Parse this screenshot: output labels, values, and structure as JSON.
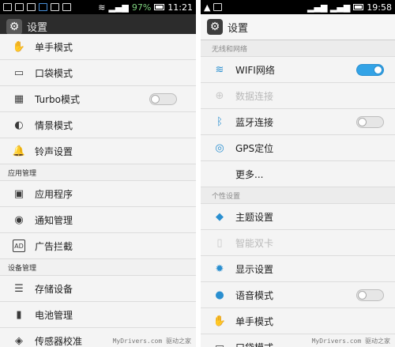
{
  "left": {
    "status": {
      "battery_pct": "97%",
      "time": "11:21"
    },
    "title": "设置",
    "rows": [
      {
        "type": "item",
        "icon": "hand-icon",
        "glyph": "✋",
        "label": "单手模式"
      },
      {
        "type": "item",
        "icon": "pocket-icon",
        "glyph": "▭",
        "label": "口袋模式"
      },
      {
        "type": "item",
        "icon": "chip-icon",
        "glyph": "▦",
        "label": "Turbo模式",
        "toggle": "off"
      },
      {
        "type": "item",
        "icon": "scene-icon",
        "glyph": "◐",
        "label": "情景模式"
      },
      {
        "type": "item",
        "icon": "bell-icon",
        "glyph": "🔔",
        "label": "铃声设置"
      },
      {
        "type": "section",
        "label": "应用管理"
      },
      {
        "type": "item",
        "icon": "apps-icon",
        "glyph": "▣",
        "label": "应用程序"
      },
      {
        "type": "item",
        "icon": "notification-icon",
        "glyph": "◉",
        "label": "通知管理"
      },
      {
        "type": "item",
        "icon": "ad-block-icon",
        "glyph": "AD",
        "label": "广告拦截"
      },
      {
        "type": "section",
        "label": "设备管理"
      },
      {
        "type": "item",
        "icon": "storage-icon",
        "glyph": "☰",
        "label": "存储设备"
      },
      {
        "type": "item",
        "icon": "battery-icon",
        "glyph": "▮",
        "label": "电池管理"
      },
      {
        "type": "item",
        "icon": "sensor-icon",
        "glyph": "◈",
        "label": "传感器校准"
      }
    ],
    "watermark": "MyDrivers.com 驱动之家"
  },
  "right": {
    "status": {
      "time": "19:58"
    },
    "title": "设置",
    "rows": [
      {
        "type": "section",
        "label": "无线和网络"
      },
      {
        "type": "item",
        "icon": "wifi-icon",
        "glyph": "≋",
        "label": "WIFI网络",
        "toggle": "on"
      },
      {
        "type": "item",
        "icon": "data-icon",
        "glyph": "⊕",
        "label": "数据连接",
        "disabled": true
      },
      {
        "type": "item",
        "icon": "bluetooth-icon",
        "glyph": "ᛒ",
        "label": "蓝牙连接",
        "toggle": "off"
      },
      {
        "type": "item",
        "icon": "gps-icon",
        "glyph": "◎",
        "label": "GPS定位"
      },
      {
        "type": "item",
        "icon": "",
        "glyph": "",
        "label": "更多..."
      },
      {
        "type": "section",
        "label": "个性设置"
      },
      {
        "type": "item",
        "icon": "theme-icon",
        "glyph": "◆",
        "label": "主题设置"
      },
      {
        "type": "item",
        "icon": "dual-sim-icon",
        "glyph": "▯",
        "label": "智能双卡",
        "disabled": true
      },
      {
        "type": "item",
        "icon": "display-icon",
        "glyph": "✹",
        "label": "显示设置"
      },
      {
        "type": "item",
        "icon": "mic-icon",
        "glyph": "●",
        "label": "语音模式",
        "toggle": "off"
      },
      {
        "type": "item",
        "icon": "hand-icon",
        "glyph": "✋",
        "label": "单手模式"
      },
      {
        "type": "item",
        "icon": "pocket-icon",
        "glyph": "▭",
        "label": "口袋模式"
      }
    ],
    "watermark": "MyDrivers.com 驱动之家"
  }
}
